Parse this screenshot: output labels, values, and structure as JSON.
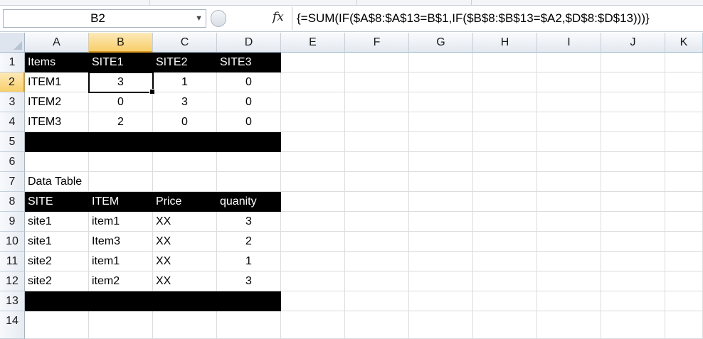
{
  "formula_bar": {
    "name_box": "B2",
    "fx_label": "fx",
    "formula": "{=SUM(IF($A$8:$A$13=B$1,IF($B$8:$B$13=$A2,$D$8:$D$13)))}"
  },
  "columns": [
    "A",
    "B",
    "C",
    "D",
    "E",
    "F",
    "G",
    "H",
    "I",
    "J",
    "K"
  ],
  "rows": [
    "1",
    "2",
    "3",
    "4",
    "5",
    "6",
    "7",
    "8",
    "9",
    "10",
    "11",
    "12",
    "13",
    "14"
  ],
  "selected_cell": "B2",
  "cells": {
    "r1": [
      "Items",
      "SITE1",
      "SITE2",
      "SITE3"
    ],
    "r2": [
      "ITEM1",
      "3",
      "1",
      "0"
    ],
    "r3": [
      "ITEM2",
      "0",
      "3",
      "0"
    ],
    "r4": [
      "ITEM3",
      "2",
      "0",
      "0"
    ],
    "r7": [
      "Data Table"
    ],
    "r8": [
      "SITE",
      "ITEM",
      "Price",
      "quanity"
    ],
    "r9": [
      "site1",
      "item1",
      "XX",
      "3"
    ],
    "r10": [
      "site1",
      "Item3",
      "XX",
      "2"
    ],
    "r11": [
      "site2",
      "item1",
      "XX",
      "1"
    ],
    "r12": [
      "site2",
      "item2",
      "XX",
      "3"
    ]
  }
}
